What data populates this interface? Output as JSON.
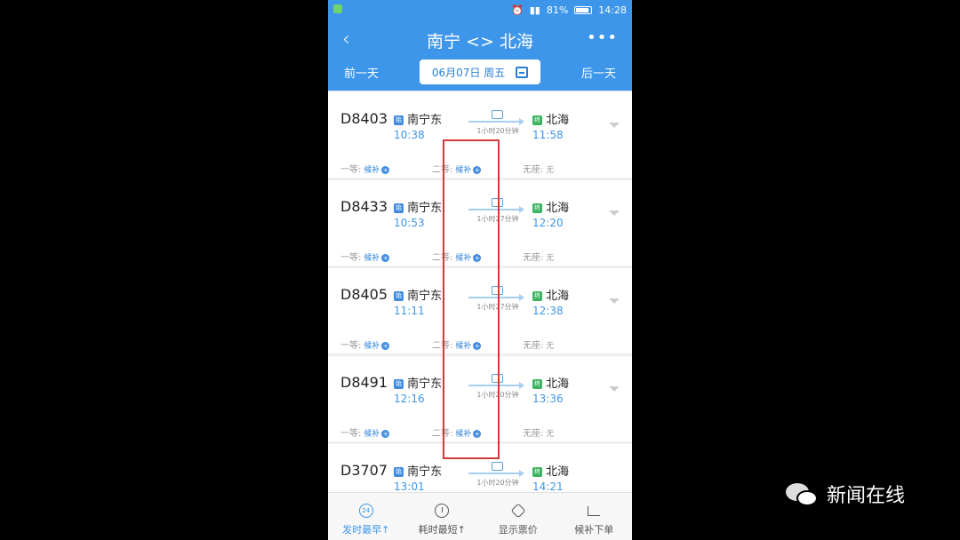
{
  "status_bar": {
    "battery": "81%",
    "time": "14:28"
  },
  "header": {
    "back_icon": "chevron-left-icon",
    "title": "南宁 <> 北海",
    "more_icon": "ellipsis-icon",
    "prev_day": "前一天",
    "date": "06月07日 周五",
    "next_day": "后一天"
  },
  "trains": [
    {
      "no": "D8403",
      "from": "南宁东",
      "from_tag": "始",
      "dep": "10:38",
      "duration": "1小时20分钟",
      "to": "北海",
      "to_tag": "终",
      "arr": "11:58",
      "seats": {
        "first_label": "一等:",
        "first_val": "候补",
        "second_label": "二等:",
        "second_val": "候补",
        "noseat_label": "无座:",
        "noseat_val": "无"
      }
    },
    {
      "no": "D8433",
      "from": "南宁东",
      "from_tag": "始",
      "dep": "10:53",
      "duration": "1小时27分钟",
      "to": "北海",
      "to_tag": "终",
      "arr": "12:20",
      "seats": {
        "first_label": "一等:",
        "first_val": "候补",
        "second_label": "二等:",
        "second_val": "候补",
        "noseat_label": "无座:",
        "noseat_val": "无"
      }
    },
    {
      "no": "D8405",
      "from": "南宁东",
      "from_tag": "始",
      "dep": "11:11",
      "duration": "1小时27分钟",
      "to": "北海",
      "to_tag": "终",
      "arr": "12:38",
      "seats": {
        "first_label": "一等:",
        "first_val": "候补",
        "second_label": "二等:",
        "second_val": "候补",
        "noseat_label": "无座:",
        "noseat_val": "无"
      }
    },
    {
      "no": "D8491",
      "from": "南宁东",
      "from_tag": "始",
      "dep": "12:16",
      "duration": "1小时20分钟",
      "to": "北海",
      "to_tag": "终",
      "arr": "13:36",
      "seats": {
        "first_label": "一等:",
        "first_val": "候补",
        "second_label": "二等:",
        "second_val": "候补",
        "noseat_label": "无座:",
        "noseat_val": "无"
      }
    },
    {
      "no": "D3707",
      "from": "南宁东",
      "from_tag": "始",
      "dep": "13:01",
      "duration": "1小时20分钟",
      "to": "北海",
      "to_tag": "终",
      "arr": "14:21"
    }
  ],
  "bottom_tabs": [
    {
      "label": "发时最早↑",
      "icon": "clock-24-icon",
      "active": true
    },
    {
      "label": "耗时最短↑",
      "icon": "timer-icon",
      "active": false
    },
    {
      "label": "显示票价",
      "icon": "price-tag-icon",
      "active": false
    },
    {
      "label": "候补下单",
      "icon": "cart-icon",
      "active": false
    }
  ],
  "watermark": {
    "text": "新闻在线",
    "icon": "wechat-icon"
  },
  "colors": {
    "header_blue": "#3d96e9",
    "highlight_red": "#d23a3a",
    "time_blue": "#3d96e9"
  }
}
